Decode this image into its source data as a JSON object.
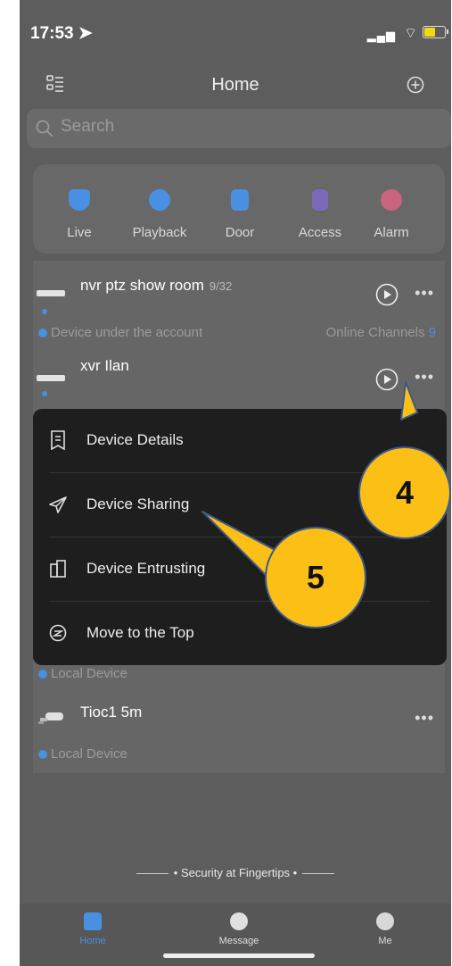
{
  "status": {
    "time": "17:53"
  },
  "nav": {
    "title": "Home"
  },
  "search": {
    "placeholder": "Search"
  },
  "quick_actions": [
    {
      "label": "Live",
      "icon": "camera-icon",
      "color": "#4a90e2"
    },
    {
      "label": "Playback",
      "icon": "playback-icon",
      "color": "#4a90e2"
    },
    {
      "label": "Door",
      "icon": "door-icon",
      "color": "#4a90e2"
    },
    {
      "label": "Access",
      "icon": "access-icon",
      "color": "#7c6ab8"
    },
    {
      "label": "Alarm",
      "icon": "alarm-icon",
      "color": "#c8647e"
    }
  ],
  "devices": [
    {
      "name": "nvr ptz show room",
      "count": "9/32",
      "sub": "Device under the account",
      "online_label": "Online Channels",
      "online_count": "9"
    },
    {
      "name": "xvr Ilan"
    },
    {
      "sub": "Local Device"
    },
    {
      "name": "Tioc1 5m",
      "sub": "Local Device"
    }
  ],
  "popup_menu": [
    {
      "label": "Device Details",
      "icon": "document-icon"
    },
    {
      "label": "Device Sharing",
      "icon": "send-icon"
    },
    {
      "label": "Device Entrusting",
      "icon": "entrust-icon"
    },
    {
      "label": "Move to the Top",
      "icon": "move-top-icon"
    }
  ],
  "callouts": {
    "c4": "4",
    "c5": "5"
  },
  "footer": {
    "slogan": "• Security at Fingertips •"
  },
  "tabs": [
    {
      "label": "Home",
      "active": true
    },
    {
      "label": "Message"
    },
    {
      "label": "Me"
    }
  ],
  "colors": {
    "accent": "#4a90e2",
    "callout": "#fbbf16",
    "popup": "#1e1e1e"
  }
}
